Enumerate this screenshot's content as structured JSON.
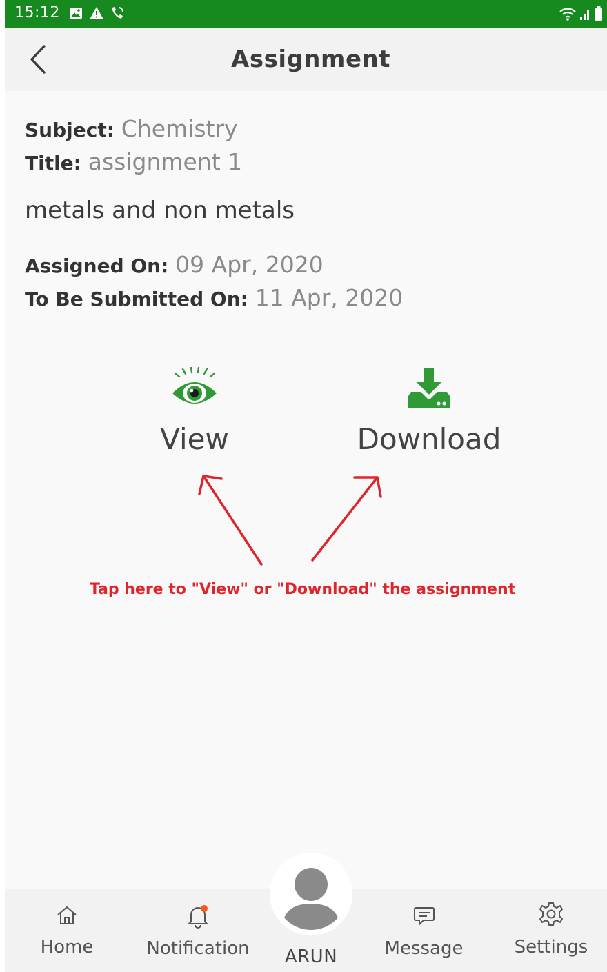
{
  "status_bar": {
    "time": "15:12",
    "icons": [
      "image-icon",
      "alert-icon",
      "call-icon",
      "wifi-icon",
      "signal-icon",
      "battery-icon"
    ],
    "background": "#168a1e"
  },
  "header": {
    "title": "Assignment"
  },
  "assignment": {
    "subject_label": "Subject:",
    "subject_value": "Chemistry",
    "title_label": "Title:",
    "title_value": "assignment 1",
    "description": "metals and non metals",
    "assigned_label": "Assigned On:",
    "assigned_value": "09 Apr, 2020",
    "due_label": "To Be Submitted On:",
    "due_value": "11 Apr, 2020"
  },
  "actions": {
    "view_label": "View",
    "download_label": "Download",
    "accent": "#2f9a36"
  },
  "annotation": {
    "hint": "Tap here to \"View\" or \"Download\" the assignment",
    "color": "#e0242c"
  },
  "bottom_nav": {
    "items": [
      {
        "label": "Home",
        "icon": "home-icon"
      },
      {
        "label": "Notification",
        "icon": "bell-icon"
      },
      {
        "label": "Message",
        "icon": "chat-icon"
      },
      {
        "label": "Settings",
        "icon": "gear-icon"
      }
    ],
    "profile_name": "ARUN",
    "notification_dot_color": "#f05a22"
  }
}
